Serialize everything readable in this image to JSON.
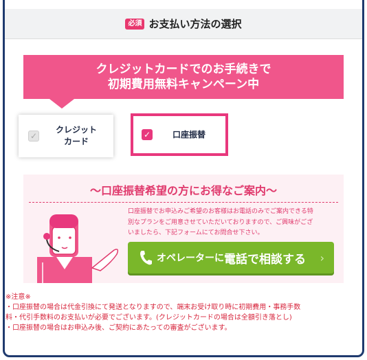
{
  "section": {
    "badge": "必須",
    "title": "お支払い方法の選択"
  },
  "campaign": {
    "line1": "クレジットカードでのお手続きで",
    "line2": "初期費用無料キャンペーン中"
  },
  "options": {
    "credit_label_1": "クレジット",
    "credit_label_2": "カード",
    "credit_checked": false,
    "bank_label": "口座振替",
    "bank_checked": true
  },
  "info": {
    "title": "～口座振替希望の方にお得なご案内～",
    "text_1": "口座振替でお申込みご希望のお客様はお電話のみでご案内できる特",
    "text_2": "別なプランをご用意させていただいておりますので、ご興味がござ",
    "text_3": "いましたら、下記フォームにてお問合せ下さい。",
    "call_small": "オペレーターに",
    "call_big": "電話で相談する",
    "chevron": "›"
  },
  "notes": {
    "head": "※注意※",
    "line_1": "・口座振替の場合は代金引換にて発送となりますので、端末お受け取り時に初期費用・事務手数",
    "line_2": "料・代引手数料のお支払いが必要でございます。(クレジットカードの場合は全額引き落とし)",
    "line_3": "・口座振替の場合はお申込み後、ご契約にあたっての審査がございます。"
  },
  "colors": {
    "accent_pink": "#f0568b",
    "select_pink": "#e8387d",
    "note_red": "#d7263d",
    "call_green": "#7ab72a",
    "frame_navy": "#1f3a6e"
  },
  "icons": [
    "checkbox-icon",
    "phone-icon",
    "chevron-right-icon",
    "operator-illustration"
  ]
}
